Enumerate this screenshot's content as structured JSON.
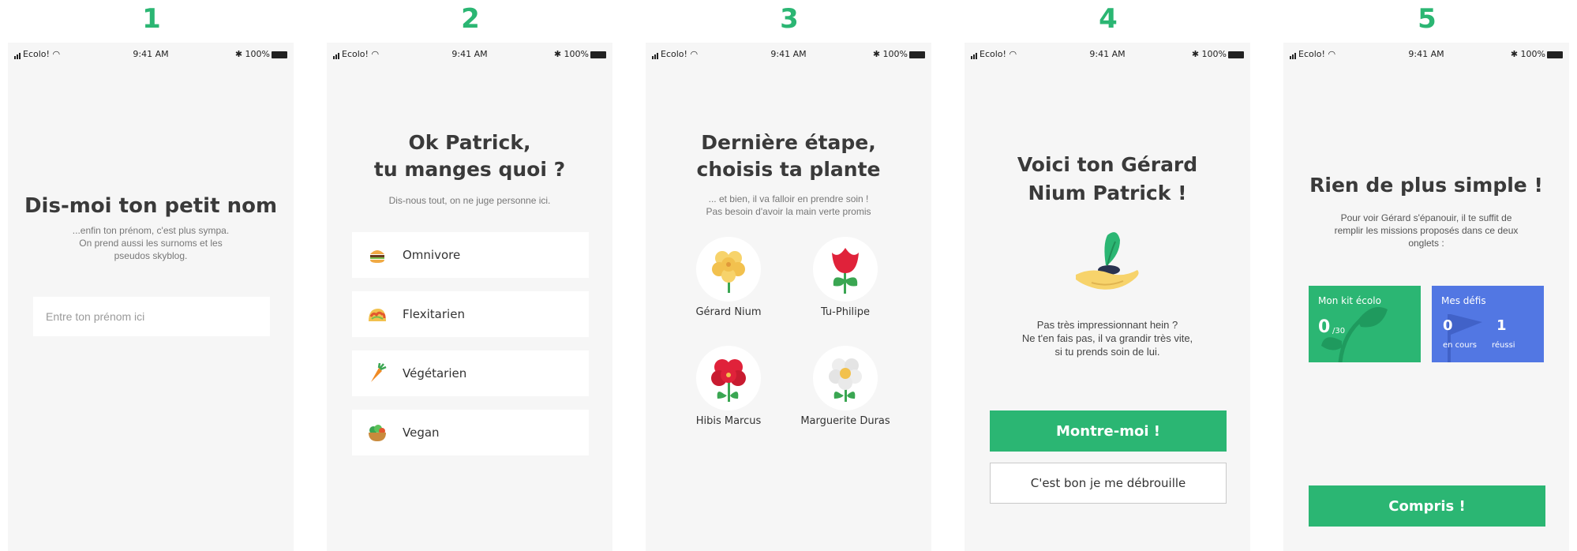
{
  "step_numbers": [
    "1",
    "2",
    "3",
    "4",
    "5"
  ],
  "status_bar": {
    "carrier": "Ecolo!",
    "time": "9:41 AM",
    "battery": "100%"
  },
  "screen1": {
    "title": "Dis-moi ton petit nom",
    "subtitle_lines": [
      "...enfin ton prénom, c'est plus sympa.",
      "On prend aussi les surnoms et les",
      "pseudos skyblog."
    ],
    "input_placeholder": "Entre ton prénom ici"
  },
  "screen2": {
    "title_lines": [
      "Ok Patrick,",
      "tu manges quoi ?"
    ],
    "subtitle": "Dis-nous tout, on ne juge personne ici.",
    "options": [
      {
        "label": "Omnivore",
        "icon": "burger-icon"
      },
      {
        "label": "Flexitarien",
        "icon": "taco-icon"
      },
      {
        "label": "Végétarien",
        "icon": "carrot-icon"
      },
      {
        "label": "Vegan",
        "icon": "salad-icon"
      }
    ]
  },
  "screen3": {
    "title_lines": [
      "Dernière étape,",
      "choisis ta plante"
    ],
    "subtitle_lines": [
      "... et bien, il va falloir en prendre soin !",
      "Pas besoin d'avoir la main verte promis"
    ],
    "plants": [
      {
        "label": "Gérard Nium",
        "icon": "yellow-geranium-icon"
      },
      {
        "label": "Tu-Philipe",
        "icon": "tulip-icon"
      },
      {
        "label": "Hibis Marcus",
        "icon": "hibiscus-icon"
      },
      {
        "label": "Marguerite Duras",
        "icon": "daisy-icon"
      }
    ]
  },
  "screen4": {
    "title_lines": [
      "Voici ton Gérard",
      "Nium Patrick !"
    ],
    "text_lines": [
      "Pas très impressionnant hein ?",
      "Ne t'en fais pas, il va grandir très vite,",
      "si tu prends soin de lui."
    ],
    "primary_button": "Montre-moi !",
    "secondary_button": "C'est bon je me débrouille"
  },
  "screen5": {
    "title": "Rien de plus simple !",
    "text_lines": [
      "Pour voir Gérard s'épanouir, il te suffit de",
      "remplir les missions proposés dans ce deux",
      "onglets :"
    ],
    "kit_card": {
      "title": "Mon kit écolo",
      "value": "0",
      "total": "/30"
    },
    "defis_card": {
      "title": "Mes défis",
      "current": "0",
      "current_label": "en cours",
      "done": "1",
      "done_label": "réussi"
    },
    "button": "Compris !"
  },
  "colors": {
    "accent_green": "#2bb673",
    "card_blue": "#5277e3",
    "screen_bg": "#f6f6f6"
  }
}
